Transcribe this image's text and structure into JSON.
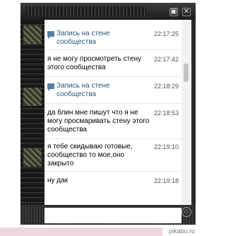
{
  "window": {
    "title": "",
    "restore_icon": "restore-icon",
    "close_icon": "close-icon",
    "restore_glyph": "▣",
    "close_glyph": "✕"
  },
  "messages": [
    {
      "text": "Запись на стене сообщества",
      "time": "22:17:25",
      "is_wall_post": true
    },
    {
      "text": "я не могу просмотреть стену этого сообщества",
      "time": "22:17:42",
      "is_wall_post": false
    },
    {
      "text": "Запись на стене сообщества",
      "time": "22:18:29",
      "is_wall_post": true
    },
    {
      "text": "да блин мне пишут что я не могу просмаривать стену этого сообщества",
      "time": "22:18:53",
      "is_wall_post": false
    },
    {
      "text": "я тебе скидываю готовые, сообщество то мое,оно закрыто",
      "time": "22:19:10",
      "is_wall_post": false
    },
    {
      "text": "ну дак",
      "time": "22:19:18",
      "is_wall_post": false
    }
  ],
  "composer": {
    "value": "",
    "smile_icon": "smile-icon",
    "smile_glyph": "☺"
  },
  "watermark": "pikabu.ru"
}
